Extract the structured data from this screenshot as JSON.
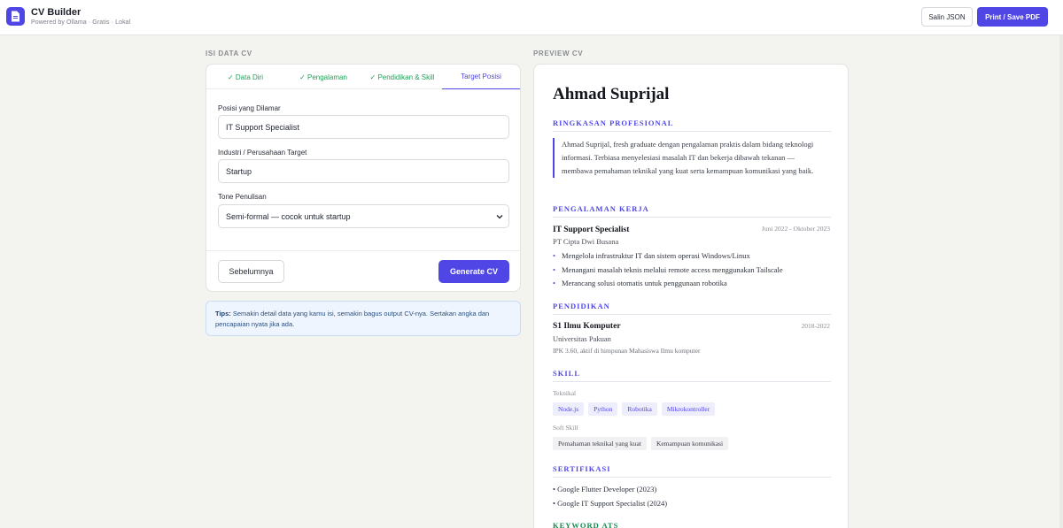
{
  "header": {
    "title": "CV Builder",
    "subtitle": "Powered by Ollama · Gratis · Lokal",
    "copy_json_label": "Salin JSON",
    "print_label": "Print / Save PDF",
    "logo_icon": "document-icon",
    "accent_color": "#4f46e5"
  },
  "form": {
    "section_label": "ISI DATA CV",
    "tabs": [
      {
        "label": "✓ Data Diri",
        "state": "done"
      },
      {
        "label": "✓ Pengalaman",
        "state": "done"
      },
      {
        "label": "✓ Pendidikan & Skill",
        "state": "done"
      },
      {
        "label": "Target Posisi",
        "state": "active"
      }
    ],
    "position_label": "Posisi yang Dilamar",
    "position_value": "IT Support Specialist",
    "industry_label": "Industri / Perusahaan Target",
    "industry_value": "Startup",
    "tone_label": "Tone Penulisan",
    "tone_value": "Semi-formal — cocok untuk startup",
    "prev_label": "Sebelumnya",
    "generate_label": "Generate CV"
  },
  "tips": {
    "label": "Tips:",
    "text": "Semakin detail data yang kamu isi, semakin bagus output CV-nya. Sertakan angka dan pencapaian nyata jika ada."
  },
  "preview": {
    "section_label": "PREVIEW CV",
    "name": "Ahmad Suprijal",
    "summary_heading": "RINGKASAN PROFESIONAL",
    "summary": "Ahmad Suprijal, fresh graduate dengan pengalaman praktis dalam bidang teknologi informasi. Terbiasa menyelesiasi masalah IT dan bekerja dibawah tekanan — membawa pemahaman teknikal yang kuat serta kemampuan komunikasi yang baik.",
    "experience_heading": "PENGALAMAN KERJA",
    "job": {
      "title": "IT Support Specialist",
      "date": "Juni 2022 - Oktober 2023",
      "company": "PT Cipta Dwi Busana",
      "bullets": [
        "Mengelola infrastruktur IT dan sistem operasi Windows/Linux",
        "Menangani masalah teknis melalui remote access menggunakan Tailscale",
        "Merancang solusi otomatis untuk penggunaan robotika"
      ]
    },
    "education_heading": "PENDIDIKAN",
    "education": {
      "degree": "S1 Ilmu Komputer",
      "years": "2018-2022",
      "school": "Universitas Pakuan",
      "note": "IPK 3.60, aktif di himpunan Mahasiswa Ilmu komputer"
    },
    "skill_heading": "SKILL",
    "technical_label": "Teknikal",
    "technical": [
      "Node.js",
      "Python",
      "Robotika",
      "Mikrokontroller"
    ],
    "soft_label": "Soft Skill",
    "soft": [
      "Pemahaman teknikal yang kuat",
      "Kemampuan komunikasi"
    ],
    "cert_heading": "SERTIFIKASI",
    "certs": [
      "• Google Flutter Developer (2023)",
      "• Google IT Support Specialist (2024)"
    ],
    "keyword_heading": "KEYWORD ATS"
  }
}
